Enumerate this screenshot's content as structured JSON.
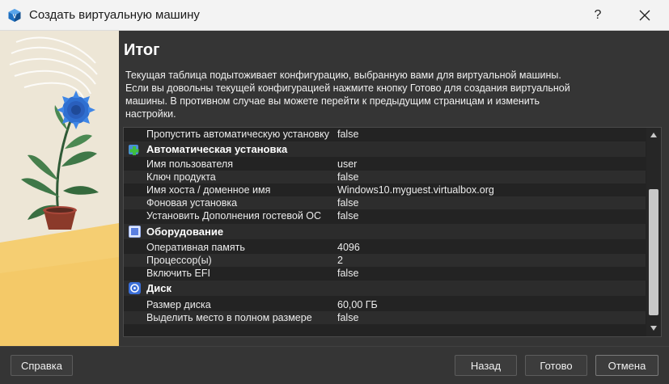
{
  "window": {
    "title": "Создать виртуальную машину",
    "help_label": "?"
  },
  "page": {
    "heading": "Итог",
    "description_lines": [
      "Текущая таблица подытоживает конфигурацию, выбранную вами для виртуальной машины.",
      "Если вы довольны текущей конфигурацией нажмите кнопку Готово для создания виртуальной",
      "машины. В противном случае вы можете перейти к предыдущим страницам и изменить",
      "настройки."
    ]
  },
  "summary": {
    "top_row": {
      "key": "Пропустить автоматическую установку",
      "value": "false"
    },
    "groups": [
      {
        "title": "Автоматическая установка",
        "icon": "unattended-install-icon",
        "rows": [
          {
            "key": "Имя пользователя",
            "value": "user"
          },
          {
            "key": "Ключ продукта",
            "value": "false"
          },
          {
            "key": "Имя хоста / доменное имя",
            "value": "Windows10.myguest.virtualbox.org"
          },
          {
            "key": "Фоновая установка",
            "value": "false"
          },
          {
            "key": "Установить Дополнения гостевой ОС",
            "value": "false"
          }
        ]
      },
      {
        "title": "Оборудование",
        "icon": "hardware-icon",
        "rows": [
          {
            "key": "Оперативная память",
            "value": "4096"
          },
          {
            "key": "Процессор(ы)",
            "value": "2"
          },
          {
            "key": "Включить EFI",
            "value": "false"
          }
        ]
      },
      {
        "title": "Диск",
        "icon": "disk-icon",
        "rows": [
          {
            "key": "Размер диска",
            "value": "60,00 ГБ"
          },
          {
            "key": "Выделить место в полном размере",
            "value": "false"
          }
        ]
      }
    ]
  },
  "buttons": {
    "help": "Справка",
    "back": "Назад",
    "finish": "Готово",
    "cancel": "Отмена"
  },
  "colors": {
    "background": "#353535",
    "table_background": "#232323",
    "accent_green": "#3fbf3f",
    "accent_blue": "#3b6fd8"
  }
}
